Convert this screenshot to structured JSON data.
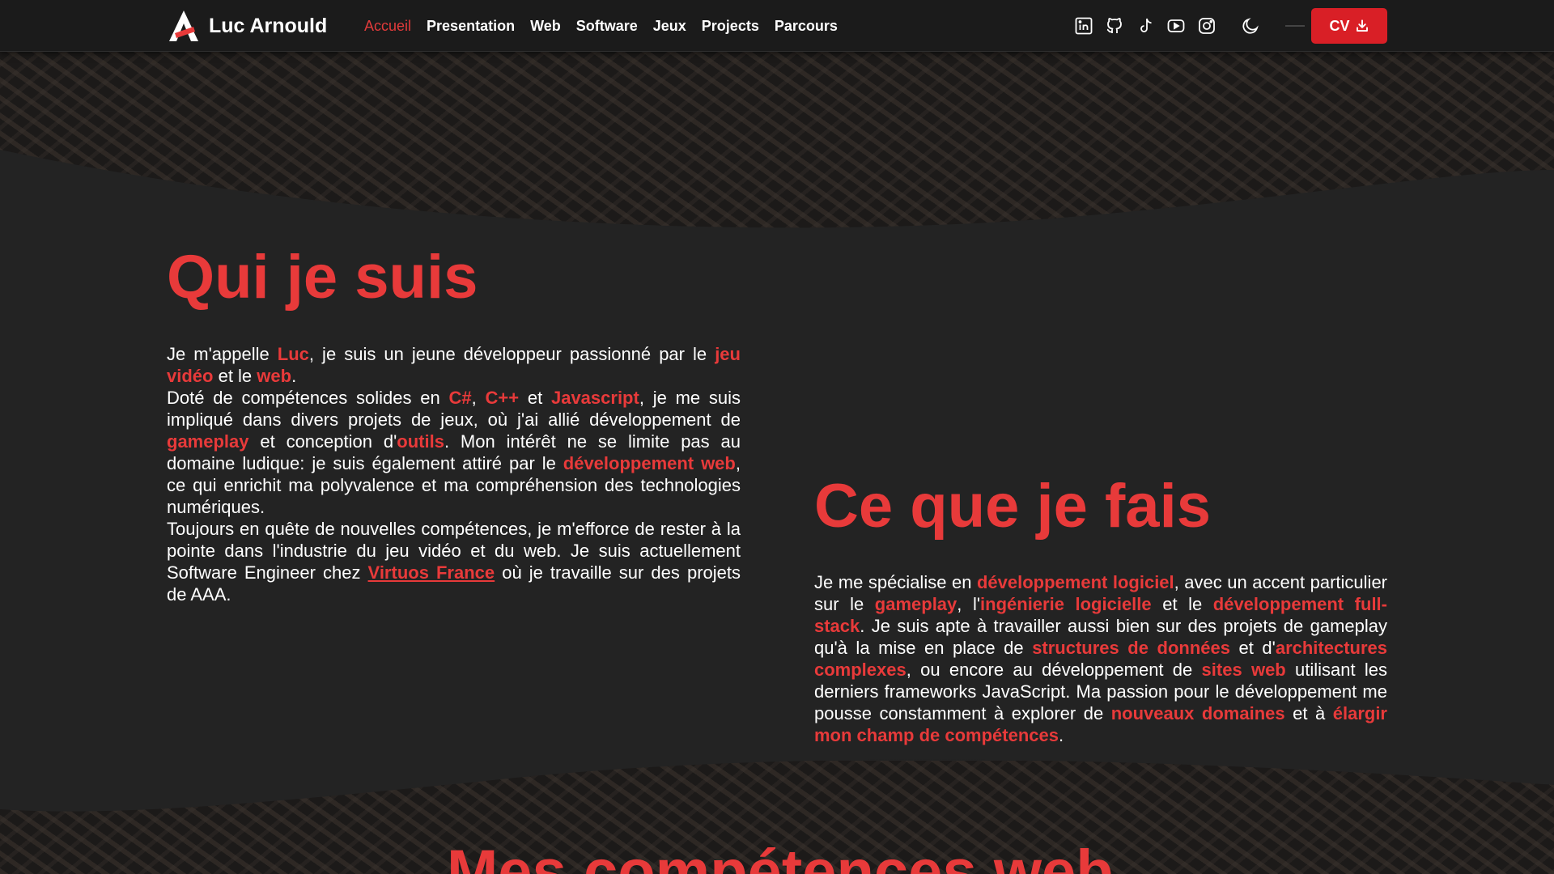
{
  "brand": {
    "name": "Luc Arnould"
  },
  "nav": {
    "links": [
      "Accueil",
      "Presentation",
      "Web",
      "Software",
      "Jeux",
      "Projects",
      "Parcours"
    ],
    "icons": [
      "linkedin-icon",
      "github-icon",
      "tiktok-icon",
      "youtube-icon",
      "instagram-icon"
    ],
    "cv_label": "CV"
  },
  "colors": {
    "accent": "#e83a3a",
    "button": "#d91f26",
    "background": "#232323",
    "navbar": "#1b1b1b"
  },
  "section1": {
    "title": "Qui je suis",
    "p1": [
      "Je m'appelle ",
      "Luc",
      ", je suis un jeune développeur passionné par le ",
      "jeu vidéo",
      " et le ",
      "web",
      "."
    ],
    "p2": [
      "Doté de compétences solides en ",
      "C#",
      ", ",
      "C++",
      " et ",
      "Javascript",
      ", je me suis impliqué dans divers projets de jeux, où j'ai allié développement de ",
      "gameplay",
      " et conception d'",
      "outils",
      ". Mon intérêt ne se limite pas au domaine ludique: je suis également attiré par le ",
      "développement web",
      ", ce qui enrichit ma polyvalence et ma compréhension des technologies numériques."
    ],
    "p3": [
      "Toujours en quête de nouvelles compétences, je m'efforce de rester à la pointe dans l'industrie du jeu vidéo et du web. Je suis actuellement Software Engineer chez ",
      "Virtuos France",
      " où je travaille sur des projets de AAA."
    ]
  },
  "section2": {
    "title": "Ce que je fais",
    "p": [
      "Je me spécialise en ",
      "développement logiciel",
      ", avec un accent particulier sur le ",
      "gameplay",
      ", l'",
      "ingénierie logicielle",
      " et le ",
      "développement full-stack",
      ". Je suis apte à travailler aussi bien sur des projets de gameplay qu'à la mise en place de ",
      "structures de données",
      " et d'",
      "architectures complexes",
      ", ou encore au développement de ",
      "sites web",
      " utilisant les derniers frameworks JavaScript. Ma passion pour le développement me pousse constamment à explorer de ",
      "nouveaux domaines",
      " et à ",
      "élargir mon champ de compétences",
      "."
    ]
  },
  "section3": {
    "title": "Mes compétences web"
  }
}
